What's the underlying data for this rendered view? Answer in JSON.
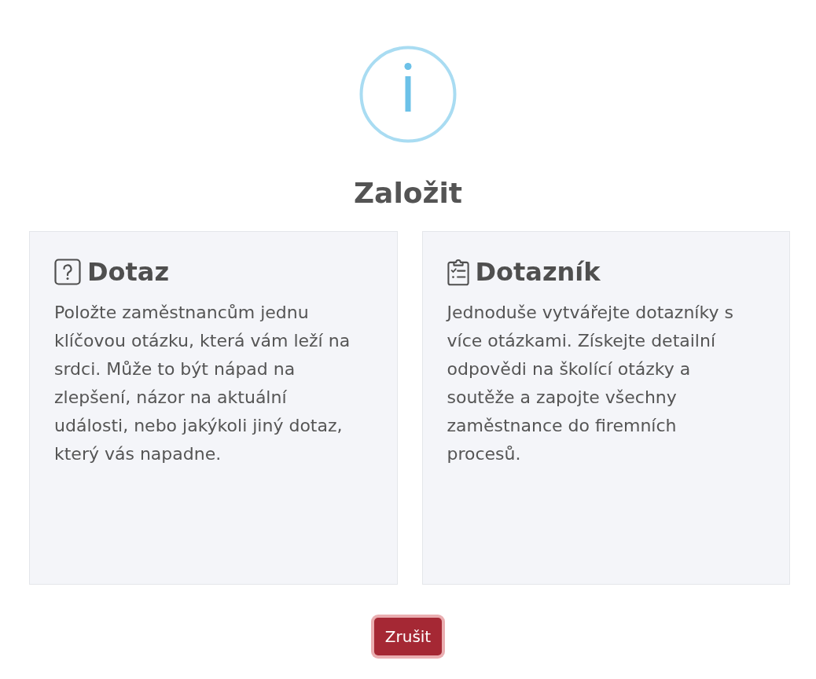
{
  "dialog": {
    "title": "Založit"
  },
  "options": [
    {
      "kind": "question",
      "title": "Dotaz",
      "description": "Položte zaměstnancům jednu klíčovou otázku, která vám leží na srdci. Může to být nápad na zlepšení, názor na aktuální události, nebo jakýkoli jiný dotaz, který vás napadne."
    },
    {
      "kind": "questionnaire",
      "title": "Dotazník",
      "description": "Jednoduše vytvářejte dotazníky s více otázkami. Získejte detailní odpovědi na školící otázky a soutěže a zapojte všechny zaměstnance do firemních procesů."
    }
  ],
  "buttons": [
    {
      "kind": "cancel",
      "label": "Zrušit",
      "focused": true
    }
  ]
}
